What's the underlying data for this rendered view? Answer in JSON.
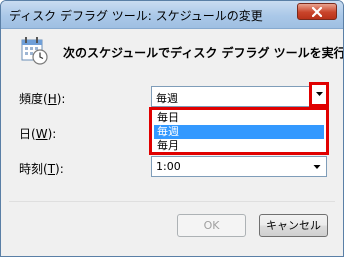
{
  "window": {
    "title": "ディスク デフラグ ツール: スケジュールの変更"
  },
  "heading": "次のスケジュールでディスク デフラグ ツールを実行する:",
  "frequency": {
    "label": "頻度(",
    "accel": "H",
    "label_suffix": "):",
    "value": "毎週",
    "options": [
      "毎日",
      "毎週",
      "毎月"
    ],
    "selected_option": "毎週"
  },
  "day": {
    "label": "日(",
    "accel": "W",
    "label_suffix": "):"
  },
  "time": {
    "label": "時刻(",
    "accel": "T",
    "label_suffix": "):",
    "value": "1:00"
  },
  "buttons": {
    "ok": "OK",
    "cancel": "キャンセル"
  },
  "colors": {
    "highlight_border": "#e00000",
    "selection": "#3399ff"
  }
}
